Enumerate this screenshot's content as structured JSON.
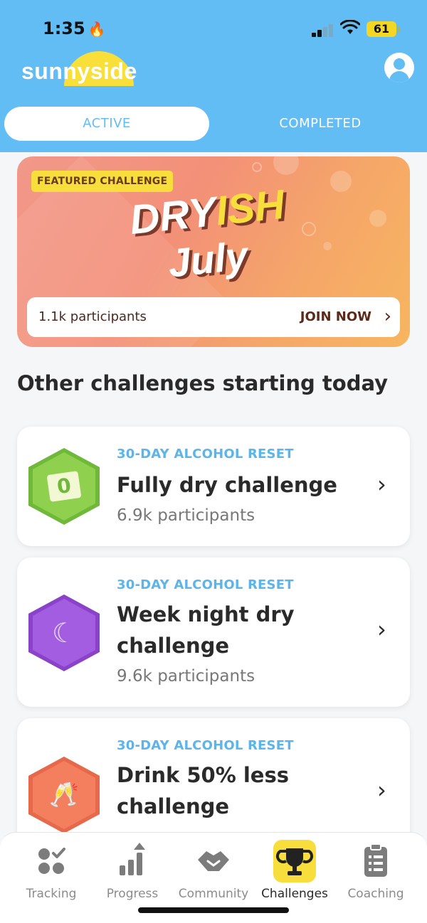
{
  "status_bar": {
    "time": "1:35",
    "battery": "61"
  },
  "header": {
    "logo_text": "sunnyside",
    "tabs": [
      {
        "label": "ACTIVE",
        "selected": true
      },
      {
        "label": "COMPLETED",
        "selected": false
      }
    ]
  },
  "featured": {
    "badge": "FEATURED CHALLENGE",
    "title_part1": "DRY",
    "title_part2": "ISH",
    "title_line2": "July",
    "participants": "1.1k participants",
    "cta": "JOIN NOW"
  },
  "section_title": "Other challenges starting today",
  "challenges": [
    {
      "kicker": "30-DAY ALCOHOL RESET",
      "title": "Fully dry challenge",
      "participants": "6.9k participants",
      "icon": "calendar-zero-icon",
      "color": "#8fd14f"
    },
    {
      "kicker": "30-DAY ALCOHOL RESET",
      "title": "Week night dry challenge",
      "participants": "9.6k participants",
      "icon": "moon-clouds-icon",
      "color": "#a25de0"
    },
    {
      "kicker": "30-DAY ALCOHOL RESET",
      "title": "Drink 50% less challenge",
      "participants": "",
      "icon": "wine-glasses-icon",
      "color": "#f47f5e"
    }
  ],
  "tabbar": {
    "items": [
      {
        "label": "Tracking",
        "icon": "tracking-icon",
        "active": false
      },
      {
        "label": "Progress",
        "icon": "progress-icon",
        "active": false
      },
      {
        "label": "Community",
        "icon": "handshake-icon",
        "active": false
      },
      {
        "label": "Challenges",
        "icon": "trophy-icon",
        "active": true
      },
      {
        "label": "Coaching",
        "icon": "clipboard-icon",
        "active": false
      }
    ]
  },
  "colors": {
    "header": "#63bdf5",
    "accent_yellow": "#f8de3c",
    "kicker_blue": "#5bb5ea"
  }
}
